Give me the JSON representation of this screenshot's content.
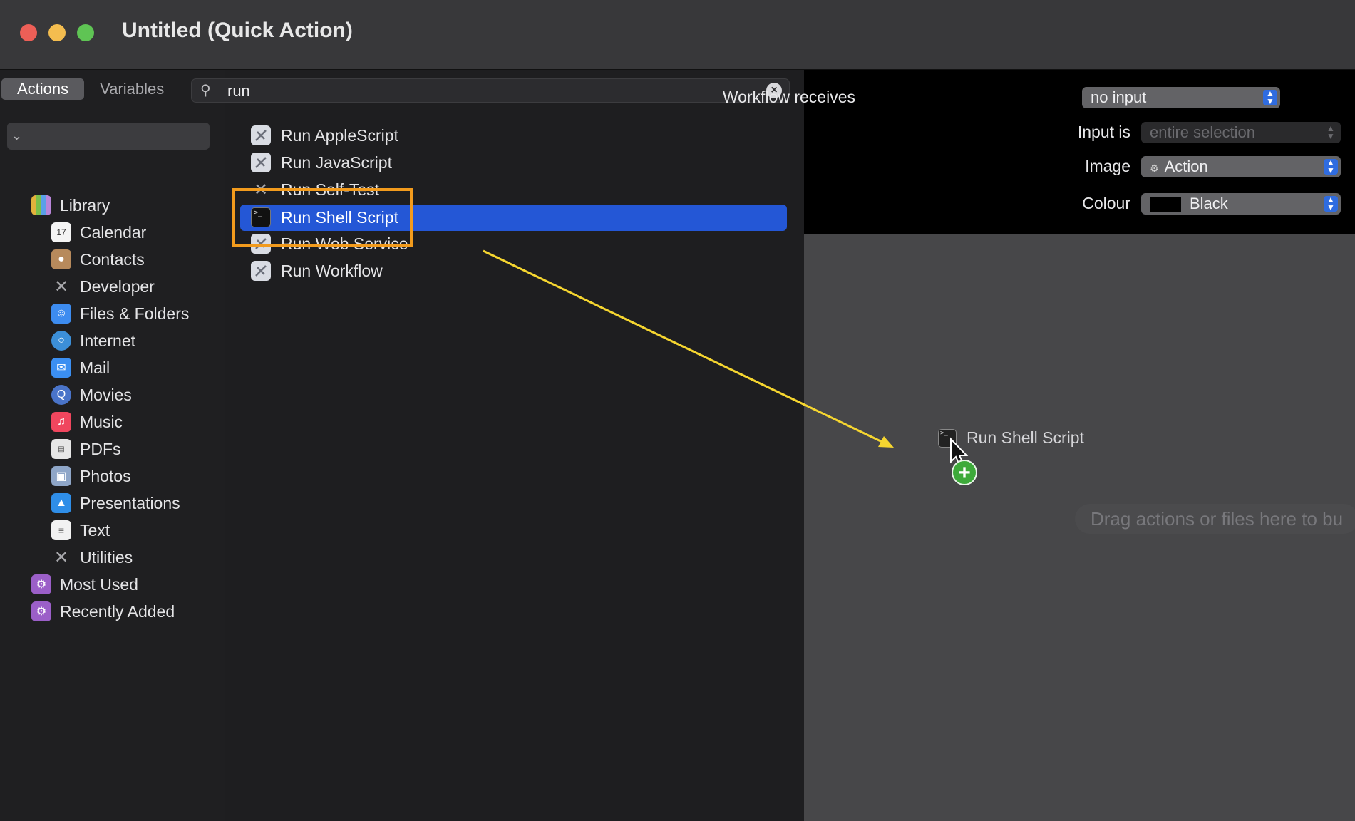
{
  "window": {
    "title": "Untitled (Quick Action)"
  },
  "library_tabs": [
    {
      "label": "Actions"
    },
    {
      "label": "Variables"
    }
  ],
  "search": {
    "value": "run",
    "placeholder": ""
  },
  "library": {
    "root": "Library",
    "items": [
      {
        "label": "Calendar",
        "icon": "calendar-icon",
        "color": "#f4f4f4"
      },
      {
        "label": "Contacts",
        "icon": "contacts-icon",
        "color": "#b78a5c"
      },
      {
        "label": "Developer",
        "icon": "tools-icon",
        "color": "#8e8e93"
      },
      {
        "label": "Files & Folders",
        "icon": "finder-icon",
        "color": "#3d8cf0"
      },
      {
        "label": "Internet",
        "icon": "globe-icon",
        "color": "#3c8fd8"
      },
      {
        "label": "Mail",
        "icon": "mail-icon",
        "color": "#3b8ff2"
      },
      {
        "label": "Movies",
        "icon": "quicktime-icon",
        "color": "#4a74c9"
      },
      {
        "label": "Music",
        "icon": "music-icon",
        "color": "#f0465e"
      },
      {
        "label": "PDFs",
        "icon": "pdf-icon",
        "color": "#e6e6e6"
      },
      {
        "label": "Photos",
        "icon": "photos-icon",
        "color": "#8fa6c8"
      },
      {
        "label": "Presentations",
        "icon": "keynote-icon",
        "color": "#2f8ee8"
      },
      {
        "label": "Text",
        "icon": "textedit-icon",
        "color": "#f2f2f2"
      },
      {
        "label": "Utilities",
        "icon": "tools-icon",
        "color": "#8e8e93"
      }
    ],
    "folders": [
      {
        "label": "Most Used"
      },
      {
        "label": "Recently Added"
      }
    ]
  },
  "actions": [
    {
      "label": "Run AppleScript",
      "icon": "script-icon"
    },
    {
      "label": "Run JavaScript",
      "icon": "script-icon"
    },
    {
      "label": "Run Self-Test",
      "icon": "tools-icon"
    },
    {
      "label": "Run Shell Script",
      "icon": "terminal-icon",
      "selected": true
    },
    {
      "label": "Run Web Service",
      "icon": "script-icon"
    },
    {
      "label": "Run Workflow",
      "icon": "script-icon"
    }
  ],
  "workflow": {
    "receives_label": "Workflow receives",
    "receives_value": "no input",
    "input_is_label": "Input is",
    "input_is_value": "entire selection",
    "image_label": "Image",
    "image_value": "Action",
    "colour_label": "Colour",
    "colour_value": "Black"
  },
  "drag": {
    "label": "Run Shell Script"
  },
  "canvas": {
    "hint": "Drag actions or files here to bu"
  },
  "colors": {
    "selection": "#2457d6",
    "highlight_box": "#f29b1d",
    "arrow": "#f6d630",
    "add_badge": "#3daa3a"
  }
}
